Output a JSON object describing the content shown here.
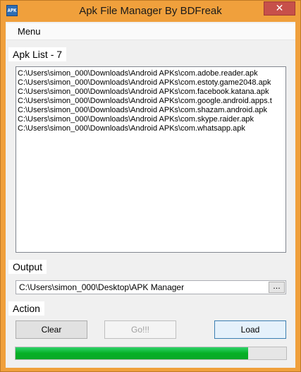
{
  "window": {
    "title": "Apk File Manager By BDFreak",
    "close_label": "✕",
    "icon_name": "app-icon"
  },
  "menubar": {
    "items": [
      {
        "label": "Menu"
      }
    ]
  },
  "apk_list": {
    "label": "Apk List - 7",
    "items": [
      "C:\\Users\\simon_000\\Downloads\\Android APKs\\com.adobe.reader.apk",
      "C:\\Users\\simon_000\\Downloads\\Android APKs\\com.estoty.game2048.apk",
      "C:\\Users\\simon_000\\Downloads\\Android APKs\\com.facebook.katana.apk",
      "C:\\Users\\simon_000\\Downloads\\Android APKs\\com.google.android.apps.t",
      "C:\\Users\\simon_000\\Downloads\\Android APKs\\com.shazam.android.apk",
      "C:\\Users\\simon_000\\Downloads\\Android APKs\\com.skype.raider.apk",
      "C:\\Users\\simon_000\\Downloads\\Android APKs\\com.whatsapp.apk"
    ]
  },
  "output": {
    "label": "Output",
    "value": "C:\\Users\\simon_000\\Desktop\\APK Manager",
    "browse_label": "..."
  },
  "action": {
    "label": "Action",
    "clear_label": "Clear",
    "go_label": "Go!!!",
    "load_label": "Load"
  },
  "progress": {
    "value": 0.86
  },
  "colors": {
    "titlebar": "#f0a03c",
    "close": "#c7504a",
    "progress": "#06b025"
  }
}
